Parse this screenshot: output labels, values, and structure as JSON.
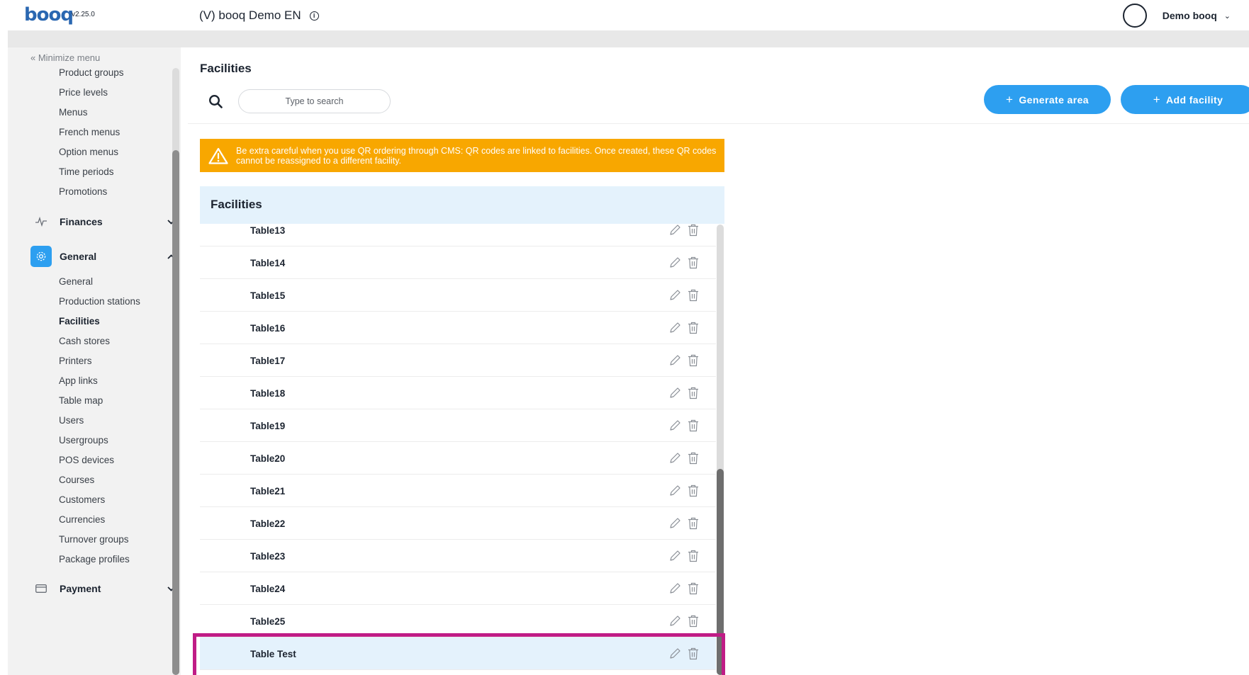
{
  "header": {
    "logo": "booq",
    "version": "v2.25.0",
    "venue": "(V) booq Demo EN",
    "user_name": "Demo booq"
  },
  "sidebar": {
    "minimize_label": "« Minimize menu",
    "top_items": [
      "Product groups",
      "Price levels",
      "Menus",
      "French menus",
      "Option menus",
      "Time periods",
      "Promotions"
    ],
    "finances_label": "Finances",
    "general_label": "General",
    "general_items": [
      "General",
      "Production stations",
      "Facilities",
      "Cash stores",
      "Printers",
      "App links",
      "Table map",
      "Users",
      "Usergroups",
      "POS devices",
      "Courses",
      "Customers",
      "Currencies",
      "Turnover groups",
      "Package profiles"
    ],
    "payment_label": "Payment",
    "active_item": "Facilities"
  },
  "main": {
    "title": "Facilities",
    "search_placeholder": "Type to search",
    "generate_label": "Generate area",
    "add_label": "Add facility",
    "warning": "Be extra careful when you use QR ordering through CMS: QR codes are linked to facilities. Once created, these QR codes cannot be reassigned to a different facility.",
    "table_title": "Facilities",
    "rows": [
      "Table13",
      "Table14",
      "Table15",
      "Table16",
      "Table17",
      "Table18",
      "Table19",
      "Table20",
      "Table21",
      "Table22",
      "Table23",
      "Table24",
      "Table25",
      "Table Test"
    ],
    "highlighted_row": "Table Test"
  },
  "colors": {
    "accent": "#2d9ff0",
    "warning": "#f8a700",
    "highlight_border": "#c01c86",
    "table_header_bg": "#e4f2fc"
  },
  "icons": [
    "info-icon",
    "search-icon",
    "warning-icon",
    "finances-icon",
    "gear-icon",
    "payment-icon",
    "edit-icon",
    "trash-icon",
    "chevron-down-icon",
    "chevron-up-icon"
  ]
}
